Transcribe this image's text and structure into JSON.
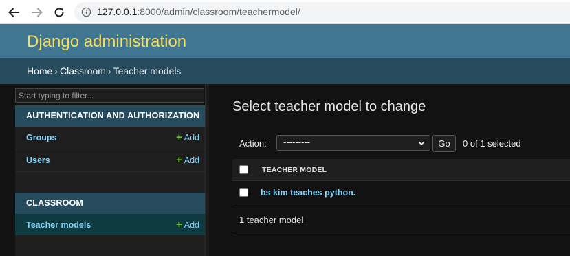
{
  "browser": {
    "url_host": "127.0.0.1",
    "url_path": ":8000/admin/classroom/teachermodel/"
  },
  "header": {
    "site_title": "Django administration"
  },
  "breadcrumbs": {
    "home": "Home",
    "separator": "›",
    "app": "Classroom",
    "current": "Teacher models"
  },
  "sidebar": {
    "filter_placeholder": "Start typing to filter...",
    "modules": [
      {
        "caption": "AUTHENTICATION AND AUTHORIZATION",
        "items": [
          {
            "label": "Groups",
            "add_label": "Add"
          },
          {
            "label": "Users",
            "add_label": "Add"
          }
        ]
      },
      {
        "caption": "CLASSROOM",
        "items": [
          {
            "label": "Teacher models",
            "add_label": "Add"
          }
        ]
      }
    ]
  },
  "main": {
    "title": "Select teacher model to change",
    "action_label": "Action:",
    "action_selected": "---------",
    "go_label": "Go",
    "selected_count": "0 of 1 selected",
    "table": {
      "column_header": "TEACHER MODEL",
      "rows": [
        "bs kim teaches python."
      ]
    },
    "paginator": "1 teacher model"
  },
  "colors": {
    "header_bg": "#417690",
    "breadcrumb_bg": "#264b5d",
    "branding": "#f5dd5d",
    "link": "#81d4fa",
    "add_plus": "#70bf2b",
    "page_bg": "#121212"
  }
}
